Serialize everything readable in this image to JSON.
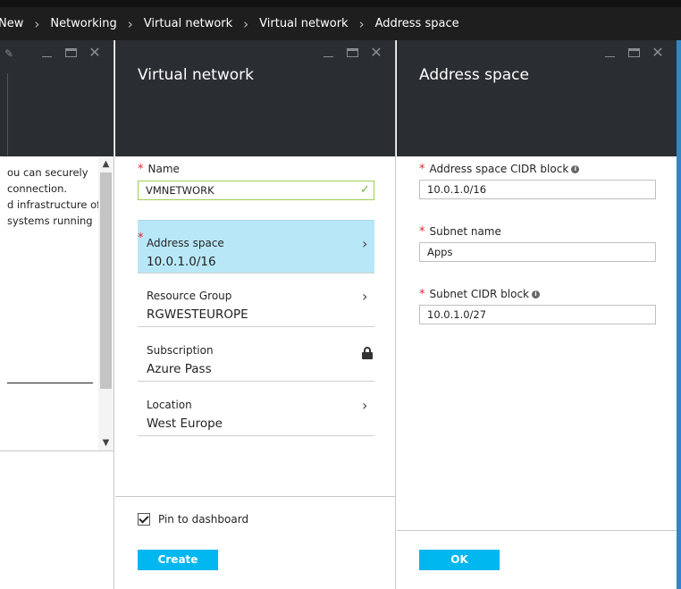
{
  "breadcrumb": [
    "New",
    "Networking",
    "Virtual network",
    "Virtual network",
    "Address space"
  ],
  "blade1": {
    "description_lines": [
      "ou can securely",
      " connection.",
      "d infrastructure of",
      "systems running"
    ]
  },
  "blade2": {
    "title": "Virtual network",
    "name_label": "Name",
    "name_value": "VMNETWORK",
    "rows": [
      {
        "label": "Address space",
        "value": "10.0.1.0/16"
      },
      {
        "label": "Resource Group",
        "value": "RGWESTEUROPE"
      },
      {
        "label": "Subscription",
        "value": "Azure Pass"
      },
      {
        "label": "Location",
        "value": "West Europe"
      }
    ],
    "pin_label": "Pin to dashboard",
    "pin_checked": true,
    "create_label": "Create"
  },
  "blade3": {
    "title": "Address space",
    "cidr_label": "Address space CIDR block",
    "cidr_value": "10.0.1.0/16",
    "subnet_name_label": "Subnet name",
    "subnet_name_value": "Apps",
    "subnet_cidr_label": "Subnet CIDR block",
    "subnet_cidr_value": "10.0.1.0/27",
    "ok_label": "OK"
  },
  "icons": {
    "info": "i",
    "chevron": "›",
    "close": "✕"
  },
  "colors": {
    "accent": "#00b7f0",
    "selected_row": "#b8e8f7",
    "header": "#2a2d31",
    "required": "#d62b2b",
    "valid": "#6db33f"
  }
}
